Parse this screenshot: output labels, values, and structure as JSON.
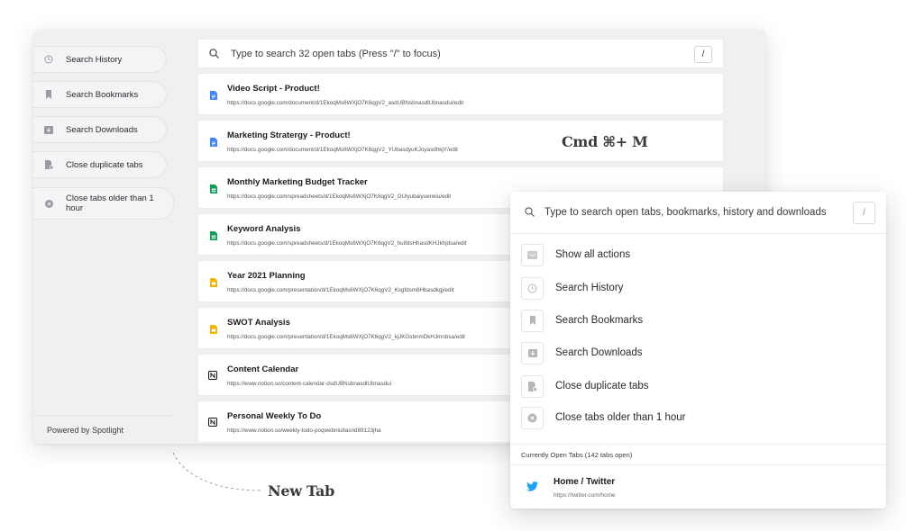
{
  "newtab": {
    "sidebar": {
      "items": [
        {
          "label": "Search History",
          "icon": "clock-icon"
        },
        {
          "label": "Search Bookmarks",
          "icon": "bookmark-icon"
        },
        {
          "label": "Search Downloads",
          "icon": "download-icon"
        },
        {
          "label": "Close duplicate tabs",
          "icon": "duplicate-file-icon"
        },
        {
          "label": "Close tabs older than 1 hour",
          "icon": "close-circle-icon"
        }
      ],
      "footer": "Powered by Spotlight"
    },
    "search": {
      "placeholder": "Type to search 32 open tabs (Press \"/\" to focus)",
      "shortcut": "/"
    },
    "tabs": [
      {
        "title": "Video Script - Product!",
        "url": "https://docs.google.com/document/d/1EkoqMs6WXjO7K6qgV2_asdUBNsbnasdlUbnasdui/edit",
        "icon": "google-docs-icon",
        "color": "#4285f4"
      },
      {
        "title": "Marketing Stratergy - Product!",
        "url": "https://docs.google.com/document/d/1EkoqMs6WXjO7K6qgV2_YUbasdyuKJoyasdhkjY/edit",
        "icon": "google-docs-icon",
        "color": "#4285f4"
      },
      {
        "title": "Monthly Marketing Budget Tracker",
        "url": "https://docs.google.com/spreadsheets/d/1EkoqMs6WXjO7K6qgV2_GUiyubaiyuerwiu/edit",
        "icon": "google-sheets-icon",
        "color": "#0f9d58"
      },
      {
        "title": "Keyword Analysis",
        "url": "https://docs.google.com/spreadsheets/d/1EkoqMs6WXjO7K6qgV2_huifdsHhasdKHJkhjdsa/edit",
        "icon": "google-sheets-icon",
        "color": "#0f9d58"
      },
      {
        "title": "Year 2021 Planning",
        "url": "https://docs.google.com/presentation/d/1EkoqMs6WXjO7K6qgV2_Ksgfdsm8Hbasdkgj/edit",
        "icon": "google-slides-icon",
        "color": "#f4b400"
      },
      {
        "title": "SWOT Analysis",
        "url": "https://docs.google.com/presentation/d/1EkoqMs6WXjO7K6qgV2_kjJKGsbnmDkHJmnbsa/edit",
        "icon": "google-slides-icon",
        "color": "#f4b400"
      },
      {
        "title": "Content Calendar",
        "url": "https://www.notion.so/content-calendar-dsdUBNsbnasdlUbnasdui",
        "icon": "notion-icon",
        "color": "#111111"
      },
      {
        "title": "Personal Weekly To Do",
        "url": "https://www.notion.so/weekly-todo-poqwebniu8asnd89123jha",
        "icon": "notion-icon",
        "color": "#111111"
      }
    ]
  },
  "annotations": {
    "shortcut": "Cmd ⌘+ M",
    "new_tab": "New Tab"
  },
  "popup": {
    "search": {
      "placeholder": "Type to search open tabs, bookmarks, history and downloads",
      "shortcut": "/"
    },
    "actions": [
      {
        "label": "Show all actions",
        "icon": "list-icon"
      },
      {
        "label": "Search History",
        "icon": "clock-icon"
      },
      {
        "label": "Search Bookmarks",
        "icon": "bookmark-icon"
      },
      {
        "label": "Search Downloads",
        "icon": "download-icon"
      },
      {
        "label": "Close duplicate tabs",
        "icon": "duplicate-file-icon"
      },
      {
        "label": "Close tabs older than 1 hour",
        "icon": "close-circle-icon"
      }
    ],
    "open_tabs_header": "Currently Open Tabs (142 tabs open)",
    "open_tabs": [
      {
        "title": "Home / Twitter",
        "url": "https://twitter.com/home",
        "icon": "twitter-icon",
        "color": "#1da1f2"
      }
    ]
  }
}
